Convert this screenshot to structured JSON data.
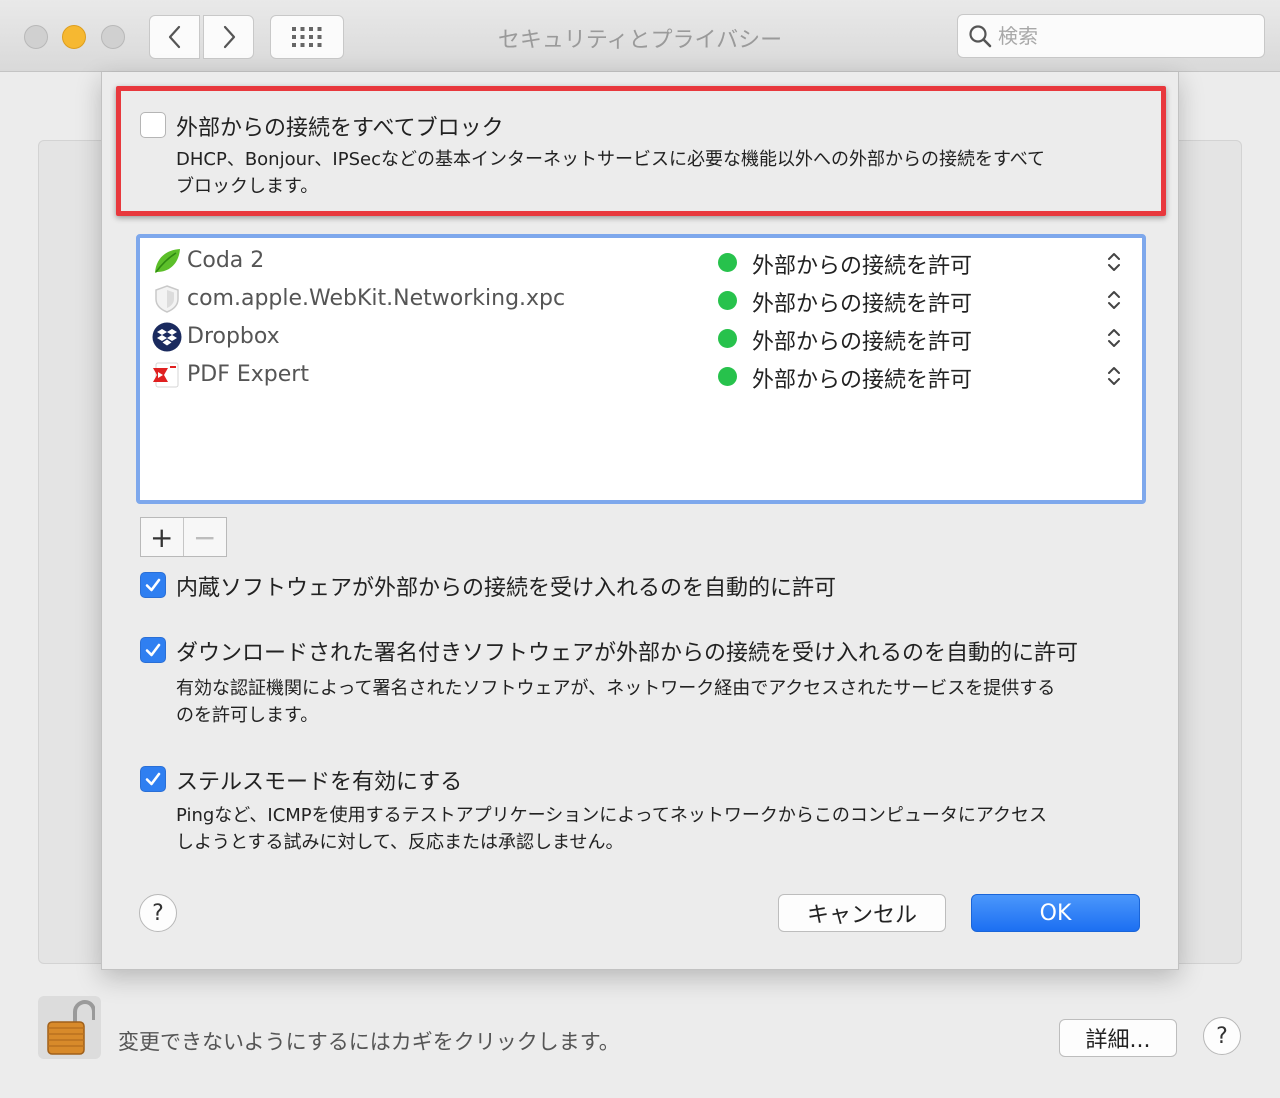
{
  "window": {
    "title": "セキュリティとプライバシー",
    "search_placeholder": "検索"
  },
  "block_all": {
    "label": "外部からの接続をすべてブロック",
    "description_line1": "DHCP、Bonjour、IPSecなどの基本インターネットサービスに必要な機能以外への外部からの接続をすべて",
    "description_line2": "ブロックします。",
    "checked": false
  },
  "apps": [
    {
      "name": "Coda 2",
      "icon": "coda-leaf-icon",
      "status": "外部からの接続を許可"
    },
    {
      "name": "com.apple.WebKit.Networking.xpc",
      "icon": "shield-icon",
      "status": "外部からの接続を許可"
    },
    {
      "name": "Dropbox",
      "icon": "dropbox-icon",
      "status": "外部からの接続を許可"
    },
    {
      "name": "PDF Expert",
      "icon": "pdf-expert-icon",
      "status": "外部からの接続を許可"
    }
  ],
  "list_controls": {
    "add": "+",
    "remove": "−"
  },
  "options": {
    "builtin": {
      "label": "内蔵ソフトウェアが外部からの接続を受け入れるのを自動的に許可",
      "checked": true
    },
    "signed": {
      "label": "ダウンロードされた署名付きソフトウェアが外部からの接続を受け入れるのを自動的に許可",
      "description_line1": "有効な認証機関によって署名されたソフトウェアが、ネットワーク経由でアクセスされたサービスを提供する",
      "description_line2": "のを許可します。",
      "checked": true
    },
    "stealth": {
      "label": "ステルスモードを有効にする",
      "description_line1": "Pingなど、ICMPを使用するテストアプリケーションによってネットワークからこのコンピュータにアクセス",
      "description_line2": "しようとする試みに対して、反応または承認しません。",
      "checked": true
    }
  },
  "buttons": {
    "help": "?",
    "cancel": "キャンセル",
    "ok": "OK",
    "details": "詳細..."
  },
  "footer": {
    "lock_text": "変更できないようにするにはカギをクリックします。"
  },
  "colors": {
    "accent": "#2f7ff1",
    "status_green": "#27c24c",
    "highlight_red": "#e8383d"
  }
}
